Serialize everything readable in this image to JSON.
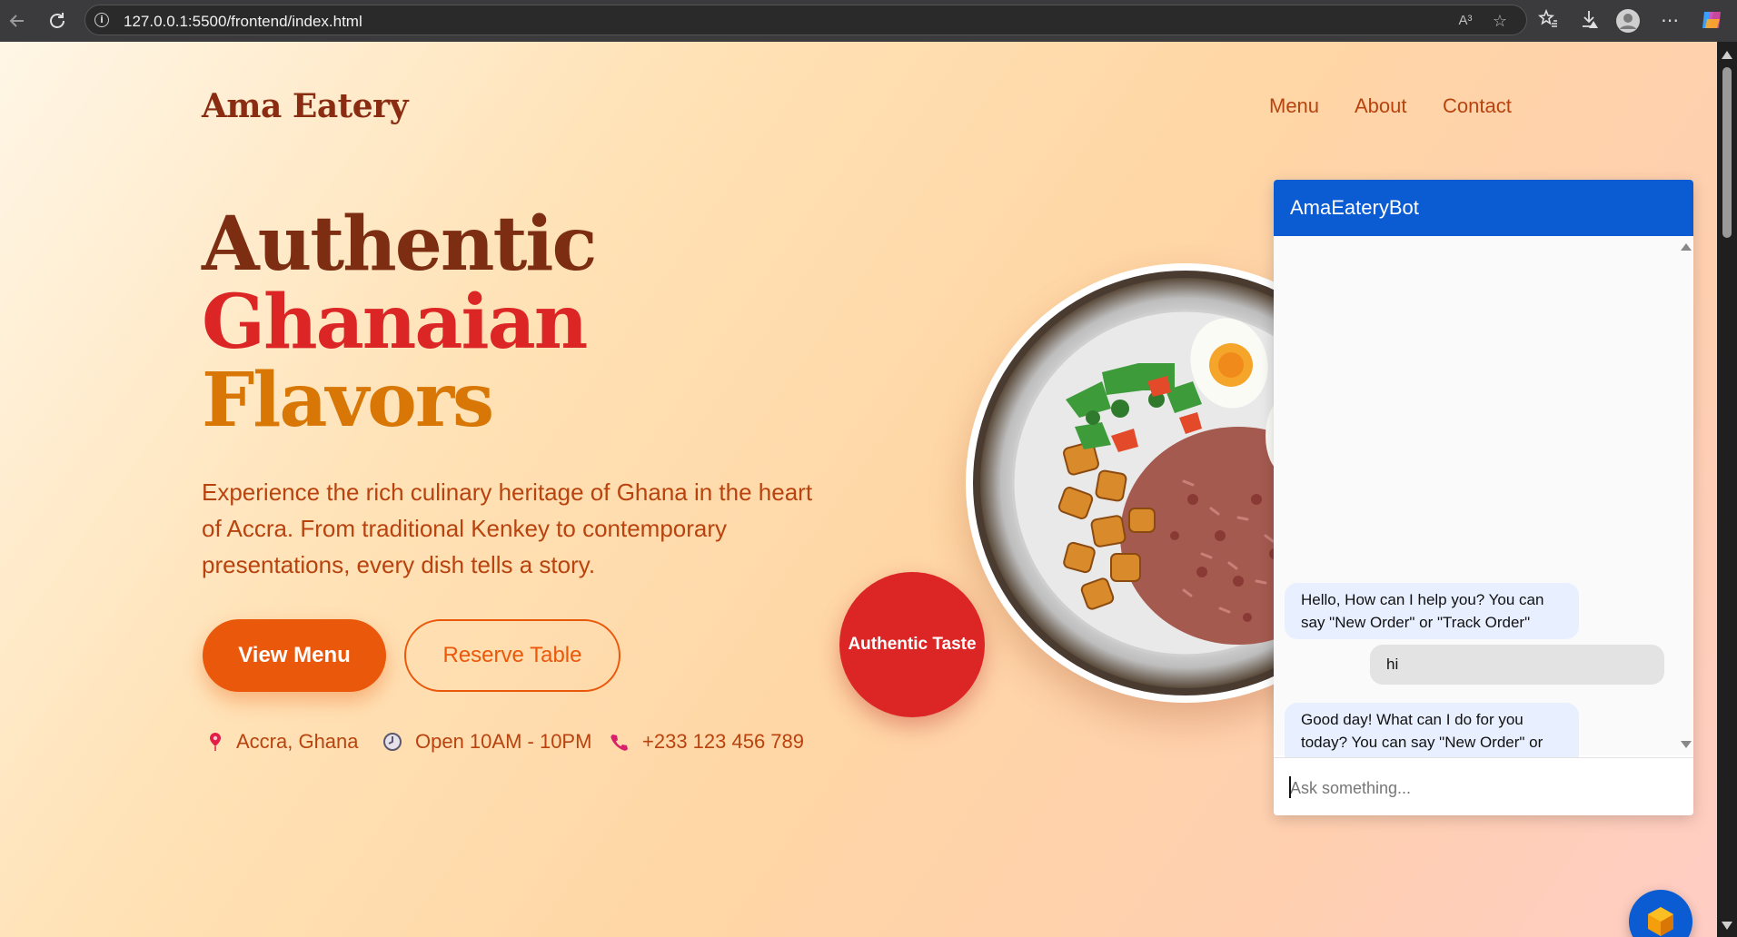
{
  "browser": {
    "url": "127.0.0.1:5500/frontend/index.html",
    "read_aloud_label": "A³"
  },
  "site": {
    "logo": "Ama Eatery",
    "nav": [
      "Menu",
      "About",
      "Contact"
    ]
  },
  "hero": {
    "title_line1": "Authentic",
    "title_line2": "Ghanaian",
    "title_line3": "Flavors",
    "description": "Experience the rich culinary heritage of Ghana in the heart of Accra. From traditional Kenkey to contemporary presentations, every dish tells a story.",
    "primary_button": "View Menu",
    "secondary_button": "Reserve Table",
    "badge": "Authentic Taste",
    "info": {
      "location": "Accra, Ghana",
      "hours": "Open 10AM - 10PM",
      "phone": "+233 123 456 789"
    }
  },
  "colors": {
    "title_brown": "#7c2d12",
    "title_red": "#dc2626",
    "title_amber": "#d97706",
    "accent_orange": "#ea580c",
    "chat_header": "#0b5bd3"
  },
  "chatbot": {
    "title": "AmaEateryBot",
    "messages": [
      {
        "from": "bot",
        "text": "Hello, How can I help you? You can say \"New Order\" or \"Track Order\""
      },
      {
        "from": "user",
        "text": "hi"
      },
      {
        "from": "bot",
        "text": "Good day! What can I do for you today? You can say \"New Order\" or \"Track Order\""
      }
    ],
    "input_placeholder": "Ask something..."
  }
}
